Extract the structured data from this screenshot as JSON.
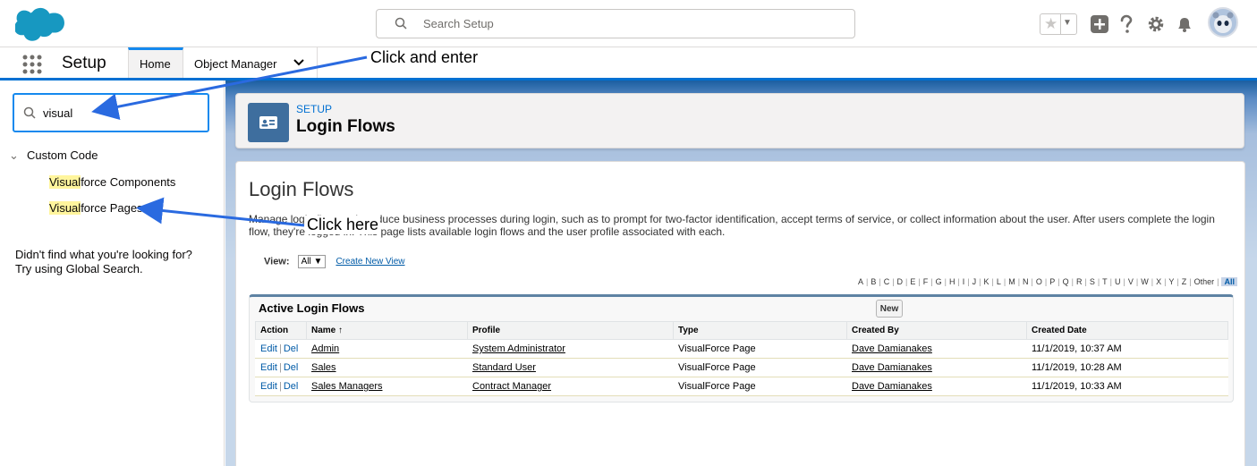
{
  "header": {
    "search_placeholder": "Search Setup"
  },
  "context_bar": {
    "app_name": "Setup",
    "tabs": [
      {
        "label": "Home"
      },
      {
        "label": "Object Manager"
      }
    ]
  },
  "sidebar": {
    "quick_find_value": "visual",
    "tree": {
      "group_label": "Custom Code",
      "items": [
        {
          "match": "Visual",
          "rest": "force Components"
        },
        {
          "match": "Visual",
          "rest": "force Pages"
        }
      ]
    },
    "not_found_line1": "Didn't find what you're looking for?",
    "not_found_line2": "Try using Global Search."
  },
  "page_header": {
    "eyebrow": "SETUP",
    "title": "Login Flows"
  },
  "content": {
    "title": "Login Flows",
    "description": "Manage login flows to introduce business processes during login, such as to prompt for two-factor identification, accept terms of service, or collect information about the user. After users complete the login flow, they're logged in. This page lists available login flows and the user profile associated with each.",
    "view_label": "View:",
    "view_value": "All ▼",
    "create_view_link": "Create New View",
    "alphabet": [
      "A",
      "B",
      "C",
      "D",
      "E",
      "F",
      "G",
      "H",
      "I",
      "J",
      "K",
      "L",
      "M",
      "N",
      "O",
      "P",
      "Q",
      "R",
      "S",
      "T",
      "U",
      "V",
      "W",
      "X",
      "Y",
      "Z",
      "Other",
      "All"
    ],
    "list": {
      "title": "Active Login Flows",
      "new_button": "New",
      "columns": [
        "Action",
        "Name ↑",
        "Profile",
        "Type",
        "Created By",
        "Created Date"
      ],
      "edit_label": "Edit",
      "del_label": "Del",
      "rows": [
        {
          "name": "Admin",
          "profile": "System Administrator",
          "type": "VisualForce Page",
          "created_by": "Dave Damianakes",
          "created_date": "11/1/2019, 10:37 AM"
        },
        {
          "name": "Sales",
          "profile": "Standard User",
          "type": "VisualForce Page",
          "created_by": "Dave Damianakes",
          "created_date": "11/1/2019, 10:28 AM"
        },
        {
          "name": "Sales Managers",
          "profile": "Contract Manager",
          "type": "VisualForce Page",
          "created_by": "Dave Damianakes",
          "created_date": "11/1/2019, 10:33 AM"
        }
      ]
    }
  },
  "annotations": {
    "callout_1": "Click and enter",
    "callout_2": "Click here"
  },
  "colors": {
    "brand_blue": "#0070d2",
    "cloud_blue": "#1798c1",
    "highlight": "#fff59d",
    "annotation_arrow": "#2a6ae0"
  }
}
